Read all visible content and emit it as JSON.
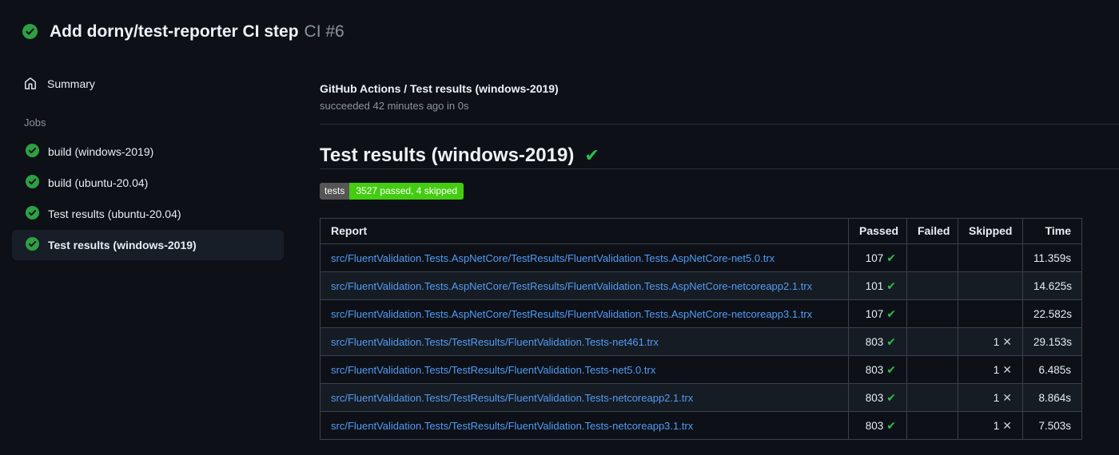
{
  "window": {
    "title": "Add dorny/test-reporter CI step",
    "run_number": "CI #6"
  },
  "sidebar": {
    "summary_label": "Summary",
    "jobs_heading": "Jobs",
    "jobs": [
      {
        "label": "build (windows-2019)",
        "selected": false
      },
      {
        "label": "build (ubuntu-20.04)",
        "selected": false
      },
      {
        "label": "Test results (ubuntu-20.04)",
        "selected": false
      },
      {
        "label": "Test results (windows-2019)",
        "selected": true
      }
    ]
  },
  "main": {
    "breadcrumb": "GitHub Actions / Test results (windows-2019)",
    "status_line": "succeeded 42 minutes ago in 0s",
    "section_title": "Test results (windows-2019)",
    "badge": {
      "label": "tests",
      "value": "3527 passed, 4 skipped"
    },
    "table": {
      "columns": [
        "Report",
        "Passed",
        "Failed",
        "Skipped",
        "Time"
      ],
      "rows": [
        {
          "report": "src/FluentValidation.Tests.AspNetCore/TestResults/FluentValidation.Tests.AspNetCore-net5.0.trx",
          "passed": "107",
          "failed": "",
          "skipped": "",
          "time": "11.359s"
        },
        {
          "report": "src/FluentValidation.Tests.AspNetCore/TestResults/FluentValidation.Tests.AspNetCore-netcoreapp2.1.trx",
          "passed": "101",
          "failed": "",
          "skipped": "",
          "time": "14.625s"
        },
        {
          "report": "src/FluentValidation.Tests.AspNetCore/TestResults/FluentValidation.Tests.AspNetCore-netcoreapp3.1.trx",
          "passed": "107",
          "failed": "",
          "skipped": "",
          "time": "22.582s"
        },
        {
          "report": "src/FluentValidation.Tests/TestResults/FluentValidation.Tests-net461.trx",
          "passed": "803",
          "failed": "",
          "skipped": "1",
          "time": "29.153s"
        },
        {
          "report": "src/FluentValidation.Tests/TestResults/FluentValidation.Tests-net5.0.trx",
          "passed": "803",
          "failed": "",
          "skipped": "1",
          "time": "6.485s"
        },
        {
          "report": "src/FluentValidation.Tests/TestResults/FluentValidation.Tests-netcoreapp2.1.trx",
          "passed": "803",
          "failed": "",
          "skipped": "1",
          "time": "8.864s"
        },
        {
          "report": "src/FluentValidation.Tests/TestResults/FluentValidation.Tests-netcoreapp3.1.trx",
          "passed": "803",
          "failed": "",
          "skipped": "1",
          "time": "7.503s"
        }
      ]
    }
  },
  "icons": {
    "check_glyph": "✔",
    "x_glyph": "✕",
    "heading_check_glyph": "✔"
  },
  "colors": {
    "background": "#0d1117",
    "success_green": "#2ea043",
    "link_blue": "#539bf5",
    "muted_text": "#8b949e",
    "badge_label_bg": "#555555",
    "badge_value_bg": "#44cc11",
    "table_border": "#3a414b",
    "row_alt_bg": "#161c23"
  }
}
